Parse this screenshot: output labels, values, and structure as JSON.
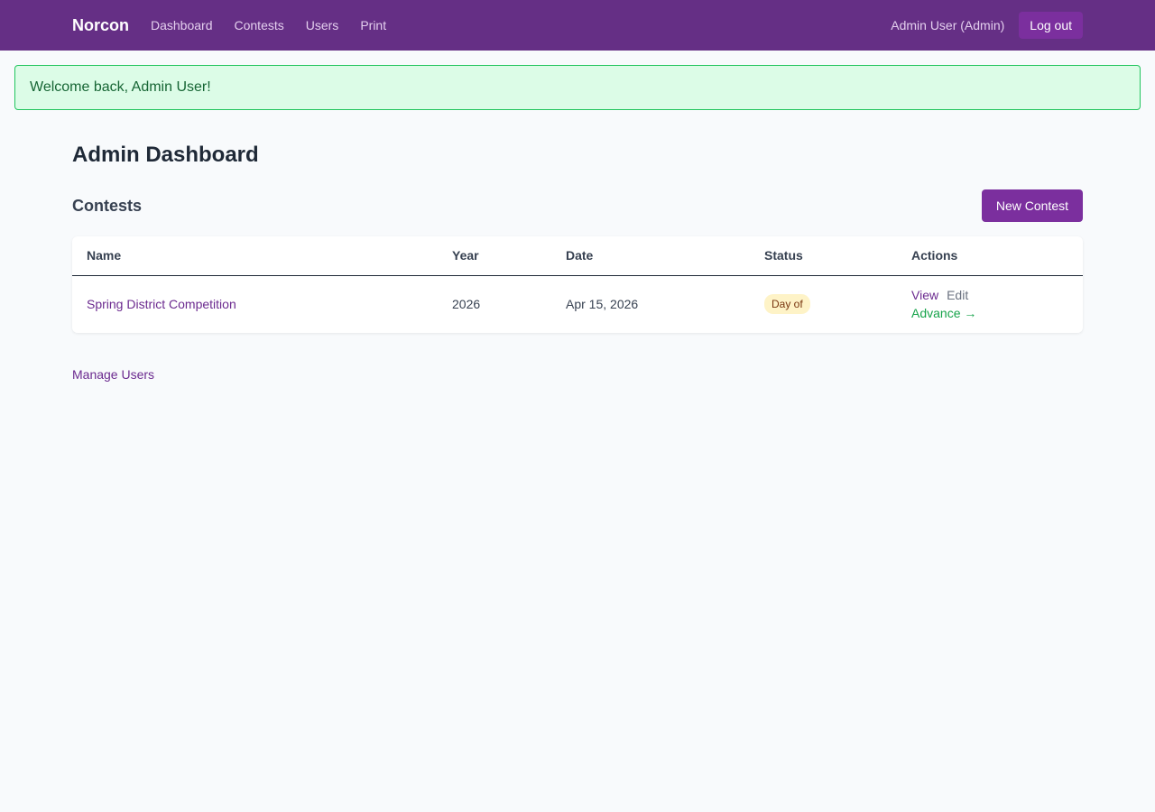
{
  "nav": {
    "brand": "Norcon",
    "links": [
      "Dashboard",
      "Contests",
      "Users",
      "Print"
    ],
    "user": "Admin User (Admin)",
    "logout": "Log out"
  },
  "flash": "Welcome back, Admin User!",
  "page_title": "Admin Dashboard",
  "contests": {
    "title": "Contests",
    "new_button": "New Contest",
    "columns": [
      "Name",
      "Year",
      "Date",
      "Status",
      "Actions"
    ],
    "rows": [
      {
        "name": "Spring District Competition",
        "year": "2026",
        "date": "Apr 15, 2026",
        "status": "Day of",
        "actions": {
          "view": "View",
          "edit": "Edit",
          "advance": "Advance →"
        }
      }
    ]
  },
  "footer_link": "Manage Users",
  "colors": {
    "nav_bg": "#652f85",
    "primary": "#7b2f9e",
    "success_bg": "#dcfce7",
    "success_border": "#22c55e",
    "badge_bg": "#fef3c7",
    "advance": "#16a34a"
  }
}
